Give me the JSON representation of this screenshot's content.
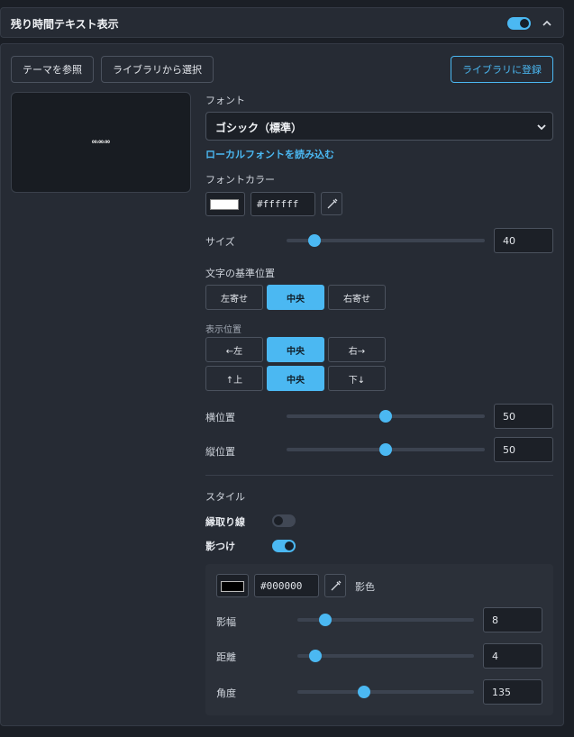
{
  "header": {
    "title": "残り時間テキスト表示",
    "enabled": true
  },
  "actions": {
    "theme": "テーマを参照",
    "library_select": "ライブラリから選択",
    "library_register": "ライブラリに登録"
  },
  "preview": {
    "text": "00:00:00"
  },
  "font": {
    "label": "フォント",
    "value": "ゴシック（標準）",
    "load_local": "ローカルフォントを読み込む"
  },
  "font_color": {
    "label": "フォントカラー",
    "hex": "#ffffff",
    "color": "#ffffff"
  },
  "size": {
    "label": "サイズ",
    "value": "40",
    "fraction": 0.14
  },
  "align": {
    "label": "文字の基準位置",
    "options": [
      "左寄せ",
      "中央",
      "右寄せ"
    ],
    "selected": "中央"
  },
  "position": {
    "label": "表示位置",
    "row1": [
      "←左",
      "中央",
      "右→"
    ],
    "row2": [
      "↑上",
      "中央",
      "下↓"
    ],
    "selected_h": "中央",
    "selected_v": "中央"
  },
  "h_pos": {
    "label": "横位置",
    "value": "50",
    "fraction": 0.5
  },
  "v_pos": {
    "label": "縦位置",
    "value": "50",
    "fraction": 0.5
  },
  "style": {
    "label": "スタイル",
    "outline_label": "縁取り線",
    "outline_on": false,
    "shadow_label": "影つけ",
    "shadow_on": true
  },
  "shadow": {
    "hex": "#000000",
    "color": "#000000",
    "color_label": "影色",
    "width": {
      "label": "影幅",
      "value": "8",
      "fraction": 0.16
    },
    "distance": {
      "label": "距離",
      "value": "4",
      "fraction": 0.1
    },
    "angle": {
      "label": "角度",
      "value": "135",
      "fraction": 0.38
    }
  },
  "colors": {
    "accent": "#4bb8f2",
    "background": "#1b1f26",
    "panel": "#262b34"
  }
}
